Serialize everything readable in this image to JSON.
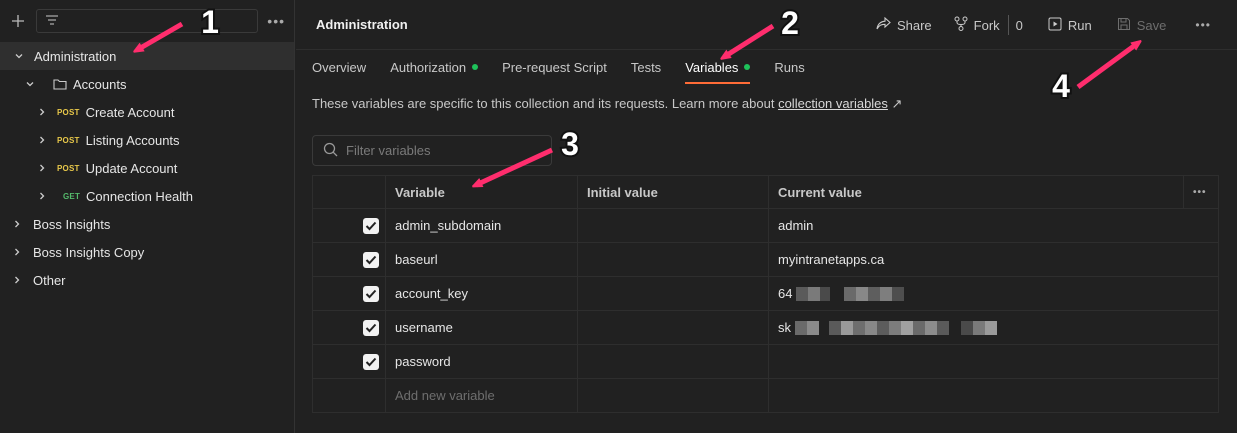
{
  "sidebar": {
    "items": [
      {
        "label": "Administration"
      },
      {
        "label": "Accounts"
      },
      {
        "method": "POST",
        "label": "Create Account"
      },
      {
        "method": "POST",
        "label": "Listing Accounts"
      },
      {
        "method": "POST",
        "label": "Update Account"
      },
      {
        "method": "GET",
        "label": "Connection Health"
      },
      {
        "label": "Boss Insights"
      },
      {
        "label": "Boss Insights Copy"
      },
      {
        "label": "Other"
      }
    ]
  },
  "header": {
    "title": "Administration",
    "share_label": "Share",
    "fork_label": "Fork",
    "fork_count": "0",
    "run_label": "Run",
    "save_label": "Save"
  },
  "tabs": [
    {
      "label": "Overview"
    },
    {
      "label": "Authorization"
    },
    {
      "label": "Pre-request Script"
    },
    {
      "label": "Tests"
    },
    {
      "label": "Variables"
    },
    {
      "label": "Runs"
    }
  ],
  "description": {
    "text": "These variables are specific to this collection and its requests. Learn more about ",
    "link": "collection variables",
    "link_icon": "↗"
  },
  "filter": {
    "placeholder": "Filter variables"
  },
  "table": {
    "columns": [
      "Variable",
      "Initial value",
      "Current value"
    ],
    "rows": [
      {
        "variable": "admin_subdomain",
        "initial": "",
        "current": "admin"
      },
      {
        "variable": "baseurl",
        "initial": "",
        "current": "myintranetapps.ca"
      },
      {
        "variable": "account_key",
        "initial": "",
        "current": "64"
      },
      {
        "variable": "username",
        "initial": "",
        "current": "sk"
      },
      {
        "variable": "password",
        "initial": "",
        "current": ""
      }
    ],
    "add_placeholder": "Add new variable"
  },
  "annotations": [
    "1",
    "2",
    "3",
    "4"
  ],
  "colors": {
    "accent": "#ff6c37",
    "status_dot": "#1ec25a",
    "post": "#e8c84a",
    "get": "#54b96b",
    "annotation": "#ff2d6d"
  }
}
